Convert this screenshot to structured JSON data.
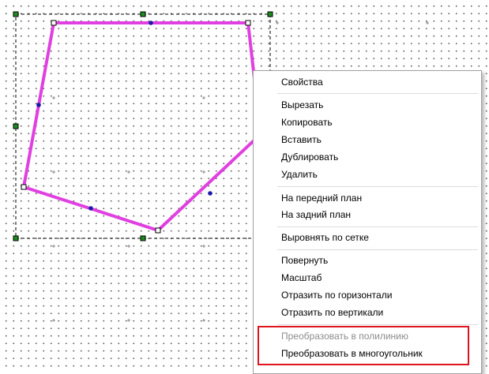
{
  "context_menu": {
    "properties": "Свойства",
    "cut": "Вырезать",
    "copy": "Копировать",
    "paste": "Вставить",
    "duplicate": "Дублировать",
    "delete": "Удалить",
    "bring_to_front": "На передний план",
    "send_to_back": "На задний план",
    "align_to_grid": "Выровнять по сетке",
    "rotate": "Повернуть",
    "scale": "Масштаб",
    "flip_horizontal": "Отразить по горизонтали",
    "flip_vertical": "Отразить по вертикали",
    "convert_to_polyline": "Преобразовать в полилинию",
    "convert_to_polygon": "Преобразовать в многоугольник"
  },
  "shape": {
    "stroke_color": "#e040e0",
    "vertex_handle_color": "#ffffff",
    "midpoint_color": "#1a1aa8",
    "selection_handle_color": "#1e8c1e"
  },
  "highlight_color": "#e0141e",
  "states": {
    "convert_to_polyline": "disabled",
    "convert_to_polygon": "enabled"
  }
}
